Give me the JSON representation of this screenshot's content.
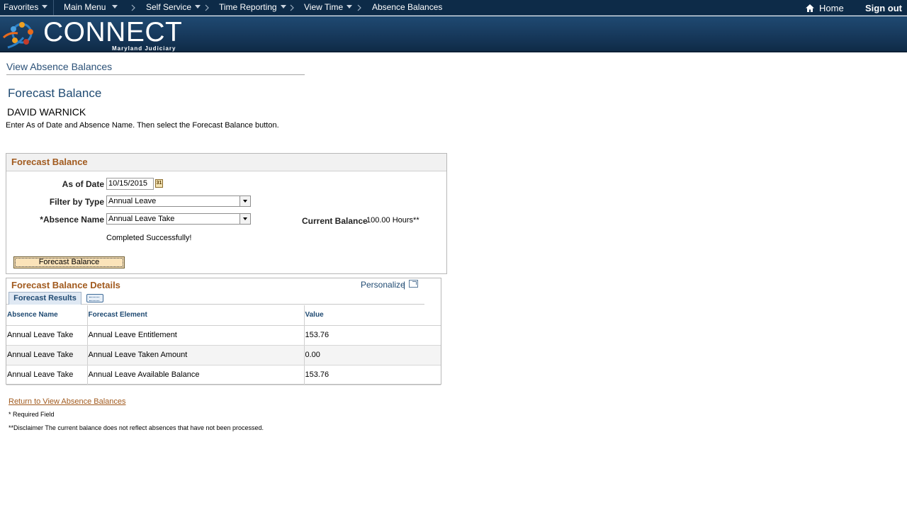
{
  "nav": {
    "favorites": "Favorites",
    "main_menu": "Main Menu",
    "self_service": "Self Service",
    "time_reporting": "Time Reporting",
    "view_time": "View Time",
    "absence_balances": "Absence Balances",
    "home": "Home",
    "sign_out": "Sign out"
  },
  "banner": {
    "logo_text": "CONNECT",
    "logo_subtext": "Maryland Judiciary"
  },
  "page": {
    "link_title": "View Absence Balances",
    "heading": "Forecast Balance",
    "employee_name": "DAVID WARNICK",
    "instructions": "Enter As of Date and Absence Name. Then select the Forecast Balance button."
  },
  "form": {
    "group_title": "Forecast Balance",
    "as_of_date_label": "As of Date",
    "as_of_date_value": "10/15/2015",
    "filter_by_type_label": "Filter by Type",
    "filter_by_type_value": "Annual Leave",
    "absence_name_label": "*Absence Name",
    "absence_name_value": "Annual Leave Take",
    "current_balance_label": "Current Balance",
    "current_balance_value": "100.00 Hours**",
    "status_message": "Completed Successfully!",
    "forecast_button": "Forecast Balance"
  },
  "details": {
    "title": "Forecast Balance Details",
    "personalize": "Personalize",
    "separator": "|",
    "tab_label": "Forecast Results",
    "columns": [
      "Absence Name",
      "Forecast Element",
      "Value"
    ],
    "rows": [
      [
        "Annual Leave Take",
        "Annual Leave Entitlement",
        "153.76"
      ],
      [
        "Annual Leave Take",
        "Annual Leave Taken Amount",
        "0.00"
      ],
      [
        "Annual Leave Take",
        "Annual Leave Available Balance",
        "153.76"
      ]
    ]
  },
  "footer": {
    "return_link": "Return to View Absence Balances",
    "required_note": "* Required Field",
    "disclaimer": "**Disclaimer  The current balance does not reflect absences that have not been processed."
  },
  "icons": {
    "home": "home-icon",
    "calendar": "calendar-icon",
    "popout": "new-window-icon",
    "show_all_columns": "show-all-columns-icon"
  },
  "colors": {
    "nav_bg": "#0d2b48",
    "banner_bg": "#17395c",
    "accent_orange": "#a15a1e",
    "link_blue": "#1f4a72",
    "button_bg": "#fbe3b9"
  }
}
